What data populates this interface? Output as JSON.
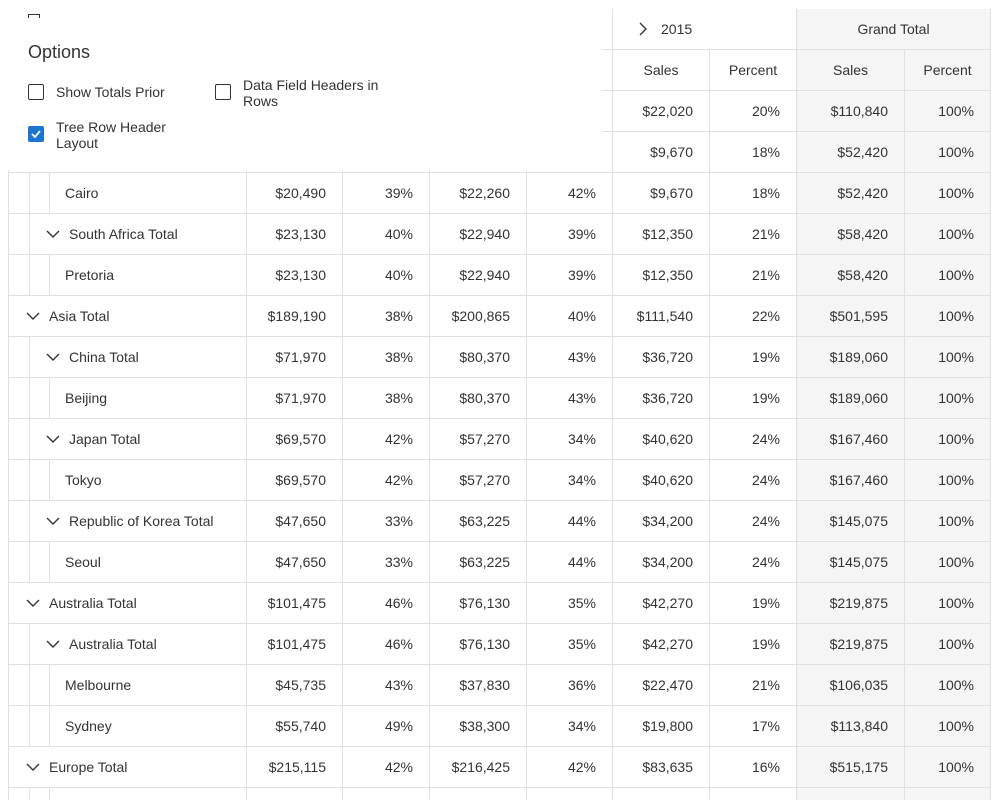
{
  "options": {
    "title": "Options",
    "show_totals_prior": {
      "label": "Show Totals Prior",
      "checked": false
    },
    "data_field_headers_in_rows": {
      "label": "Data Field Headers in Rows",
      "checked": false
    },
    "tree_row_header_layout": {
      "label": "Tree Row Header Layout",
      "checked": true
    }
  },
  "header": {
    "year_label": "2015",
    "grand_total_label": "Grand Total",
    "sales_label": "Sales",
    "percent_label": "Percent"
  },
  "rows": [
    {
      "type": "partial",
      "s2015": "$22,020",
      "p2015": "20%",
      "gts": "$110,840",
      "gtp": "100%"
    },
    {
      "type": "partial",
      "s2015": "$9,670",
      "p2015": "18%",
      "gts": "$52,420",
      "gtp": "100%"
    },
    {
      "type": "leaf",
      "label": "Cairo",
      "s1": "$20,490",
      "p1": "39%",
      "s2": "$22,260",
      "p2": "42%",
      "s2015": "$9,670",
      "p2015": "18%",
      "gts": "$52,420",
      "gtp": "100%"
    },
    {
      "type": "sub",
      "label": "South Africa Total",
      "s1": "$23,130",
      "p1": "40%",
      "s2": "$22,940",
      "p2": "39%",
      "s2015": "$12,350",
      "p2015": "21%",
      "gts": "$58,420",
      "gtp": "100%"
    },
    {
      "type": "leaf",
      "label": "Pretoria",
      "s1": "$23,130",
      "p1": "40%",
      "s2": "$22,940",
      "p2": "39%",
      "s2015": "$12,350",
      "p2015": "21%",
      "gts": "$58,420",
      "gtp": "100%"
    },
    {
      "type": "top",
      "label": "Asia Total",
      "s1": "$189,190",
      "p1": "38%",
      "s2": "$200,865",
      "p2": "40%",
      "s2015": "$111,540",
      "p2015": "22%",
      "gts": "$501,595",
      "gtp": "100%"
    },
    {
      "type": "sub",
      "label": "China Total",
      "s1": "$71,970",
      "p1": "38%",
      "s2": "$80,370",
      "p2": "43%",
      "s2015": "$36,720",
      "p2015": "19%",
      "gts": "$189,060",
      "gtp": "100%"
    },
    {
      "type": "leaf",
      "label": "Beijing",
      "s1": "$71,970",
      "p1": "38%",
      "s2": "$80,370",
      "p2": "43%",
      "s2015": "$36,720",
      "p2015": "19%",
      "gts": "$189,060",
      "gtp": "100%"
    },
    {
      "type": "sub",
      "label": "Japan Total",
      "s1": "$69,570",
      "p1": "42%",
      "s2": "$57,270",
      "p2": "34%",
      "s2015": "$40,620",
      "p2015": "24%",
      "gts": "$167,460",
      "gtp": "100%"
    },
    {
      "type": "leaf",
      "label": "Tokyo",
      "s1": "$69,570",
      "p1": "42%",
      "s2": "$57,270",
      "p2": "34%",
      "s2015": "$40,620",
      "p2015": "24%",
      "gts": "$167,460",
      "gtp": "100%"
    },
    {
      "type": "sub",
      "label": "Republic of Korea Total",
      "s1": "$47,650",
      "p1": "33%",
      "s2": "$63,225",
      "p2": "44%",
      "s2015": "$34,200",
      "p2015": "24%",
      "gts": "$145,075",
      "gtp": "100%"
    },
    {
      "type": "leaf",
      "label": "Seoul",
      "s1": "$47,650",
      "p1": "33%",
      "s2": "$63,225",
      "p2": "44%",
      "s2015": "$34,200",
      "p2015": "24%",
      "gts": "$145,075",
      "gtp": "100%"
    },
    {
      "type": "top",
      "label": "Australia Total",
      "s1": "$101,475",
      "p1": "46%",
      "s2": "$76,130",
      "p2": "35%",
      "s2015": "$42,270",
      "p2015": "19%",
      "gts": "$219,875",
      "gtp": "100%"
    },
    {
      "type": "sub",
      "label": "Australia Total",
      "s1": "$101,475",
      "p1": "46%",
      "s2": "$76,130",
      "p2": "35%",
      "s2015": "$42,270",
      "p2015": "19%",
      "gts": "$219,875",
      "gtp": "100%"
    },
    {
      "type": "leaf",
      "label": "Melbourne",
      "s1": "$45,735",
      "p1": "43%",
      "s2": "$37,830",
      "p2": "36%",
      "s2015": "$22,470",
      "p2015": "21%",
      "gts": "$106,035",
      "gtp": "100%"
    },
    {
      "type": "leaf",
      "label": "Sydney",
      "s1": "$55,740",
      "p1": "49%",
      "s2": "$38,300",
      "p2": "34%",
      "s2015": "$19,800",
      "p2015": "17%",
      "gts": "$113,840",
      "gtp": "100%"
    },
    {
      "type": "top",
      "label": "Europe Total",
      "s1": "$215,115",
      "p1": "42%",
      "s2": "$216,425",
      "p2": "42%",
      "s2015": "$83,635",
      "p2015": "16%",
      "gts": "$515,175",
      "gtp": "100%"
    },
    {
      "type": "leaf",
      "label": "",
      "s1": "",
      "p1": "",
      "s2": "",
      "p2": "",
      "s2015": "",
      "p2015": "",
      "gts": "",
      "gtp": ""
    }
  ]
}
